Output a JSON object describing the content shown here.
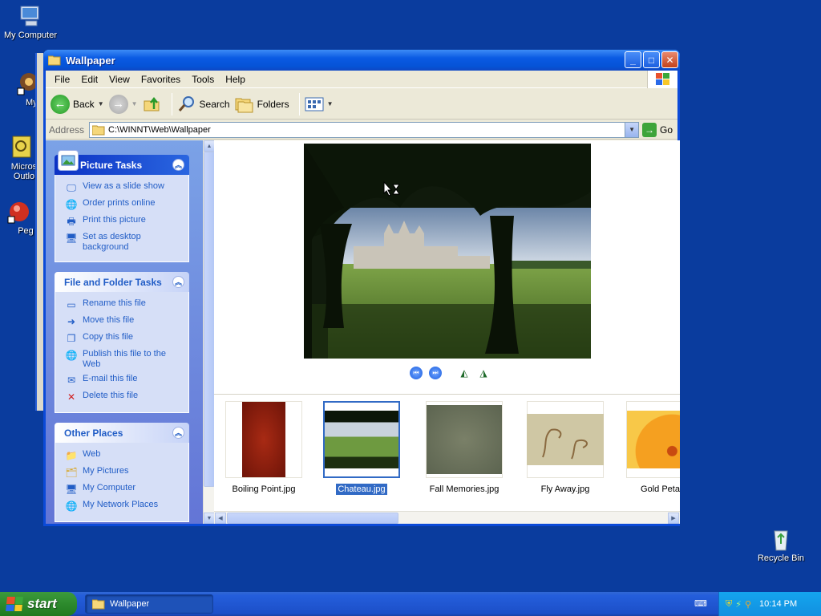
{
  "desktop": {
    "icons": [
      {
        "label": "My Computer"
      },
      {
        "label": "MyPa"
      },
      {
        "label": "Micros Outlo"
      },
      {
        "label": "Peg"
      },
      {
        "label": "Recycle Bin"
      }
    ]
  },
  "window": {
    "title": "Wallpaper",
    "menu": [
      "File",
      "Edit",
      "View",
      "Favorites",
      "Tools",
      "Help"
    ],
    "toolbar": {
      "back": "Back",
      "search": "Search",
      "folders": "Folders"
    },
    "address": {
      "label": "Address",
      "value": "C:\\WINNT\\Web\\Wallpaper",
      "go": "Go"
    }
  },
  "taskpane": {
    "picture_tasks": {
      "title": "Picture Tasks",
      "items": [
        "View as a slide show",
        "Order prints online",
        "Print this picture",
        "Set as desktop background"
      ]
    },
    "file_folder_tasks": {
      "title": "File and Folder Tasks",
      "items": [
        "Rename this file",
        "Move this file",
        "Copy this file",
        "Publish this file to the Web",
        "E-mail this file",
        "Delete this file"
      ]
    },
    "other_places": {
      "title": "Other Places",
      "items": [
        "Web",
        "My Pictures",
        "My Computer",
        "My Network Places"
      ]
    }
  },
  "filmstrip": {
    "items": [
      {
        "name": "Boiling Point.jpg",
        "selected": false
      },
      {
        "name": "Chateau.jpg",
        "selected": true
      },
      {
        "name": "Fall Memories.jpg",
        "selected": false
      },
      {
        "name": "Fly Away.jpg",
        "selected": false
      },
      {
        "name": "Gold Petals.",
        "selected": false
      }
    ]
  },
  "taskbar": {
    "start": "start",
    "task_button": "Wallpaper",
    "clock": "10:14 PM"
  },
  "colors": {
    "desktop": "#0a3c9e",
    "titlebar": "#0a5ae3",
    "taskpane": "#6f8fe0",
    "link": "#215dc6",
    "selection": "#316ac5",
    "start_green": "#2d8a2d",
    "tray": "#1290e0"
  }
}
